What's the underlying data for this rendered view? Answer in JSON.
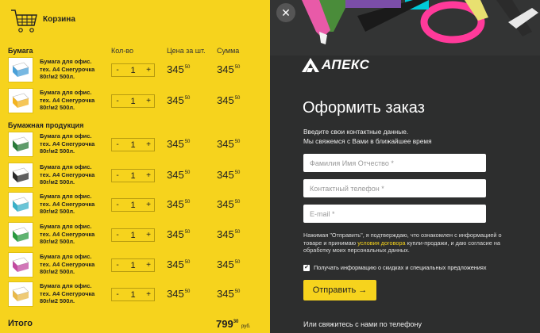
{
  "cart": {
    "title": "Корзина",
    "col_qty": "Кол-во",
    "col_price": "Цена за шт.",
    "col_sum": "Сумма",
    "sections": [
      {
        "title": "Бумага",
        "items": [
          {
            "name": "Бумага для офис. тех. А4 Снегурочка 80г/м2 500л.",
            "qty": "1",
            "price": "345",
            "price_cents": "50",
            "sum": "345",
            "sum_cents": "50"
          },
          {
            "name": "Бумага для офис. тех. А4 Снегурочка 80г/м2 500л.",
            "qty": "1",
            "price": "345",
            "price_cents": "50",
            "sum": "345",
            "sum_cents": "50"
          }
        ]
      },
      {
        "title": "Бумажная продукция",
        "items": [
          {
            "name": "Бумага для офис. тех. А4 Снегурочка 80г/м2 500л.",
            "qty": "1",
            "price": "345",
            "price_cents": "50",
            "sum": "345",
            "sum_cents": "50"
          },
          {
            "name": "Бумага для офис. тех. А4 Снегурочка 80г/м2 500л.",
            "qty": "1",
            "price": "345",
            "price_cents": "50",
            "sum": "345",
            "sum_cents": "50"
          },
          {
            "name": "Бумага для офис. тех. А4 Снегурочка 80г/м2 500л.",
            "qty": "1",
            "price": "345",
            "price_cents": "50",
            "sum": "345",
            "sum_cents": "50"
          },
          {
            "name": "Бумага для офис. тех. А4 Снегурочка 80г/м2 500л.",
            "qty": "1",
            "price": "345",
            "price_cents": "50",
            "sum": "345",
            "sum_cents": "50"
          },
          {
            "name": "Бумага для офис. тех. А4 Снегурочка 80г/м2 500л.",
            "qty": "1",
            "price": "345",
            "price_cents": "50",
            "sum": "345",
            "sum_cents": "50"
          },
          {
            "name": "Бумага для офис. тех. А4 Снегурочка 80г/м2 500л.",
            "qty": "1",
            "price": "345",
            "price_cents": "50",
            "sum": "345",
            "sum_cents": "50"
          }
        ]
      }
    ],
    "minus": "-",
    "plus": "+",
    "total_label": "Итого",
    "total_value": "799",
    "total_cents": "30",
    "total_currency": "руб."
  },
  "order": {
    "close_symbol": "✕",
    "logo_text": "АПЕКС",
    "title": "Оформить заказ",
    "subtitle_line1": "Введите свои контактные данные.",
    "subtitle_line2": "Мы свяжемся с Вами в ближайшее время",
    "name_placeholder": "Фамилия Имя Отчество *",
    "phone_placeholder": "Контактный телефон *",
    "email_placeholder": "E-mail *",
    "consent_before": "Нажимая \"Отправить\", я подтверждаю, что ознакомлен с информацией о товаре и принимаю ",
    "consent_link": "условия договора",
    "consent_after": " купли-продажи, и даю согласие на обработку моих персональных данных.",
    "newsletter_checked": true,
    "newsletter_label": "Получать информацию о скидках и специальных предложениях",
    "submit_label": "Отправить →",
    "contact_phone": "Или свяжитесь с нами по телефону"
  },
  "colors": {
    "accent": "#f6d31d",
    "dark": "#2d2e2e"
  },
  "icons": [
    "cart-icon",
    "close-icon",
    "apex-logo-icon",
    "paper-product-icon",
    "checkbox-icon"
  ]
}
